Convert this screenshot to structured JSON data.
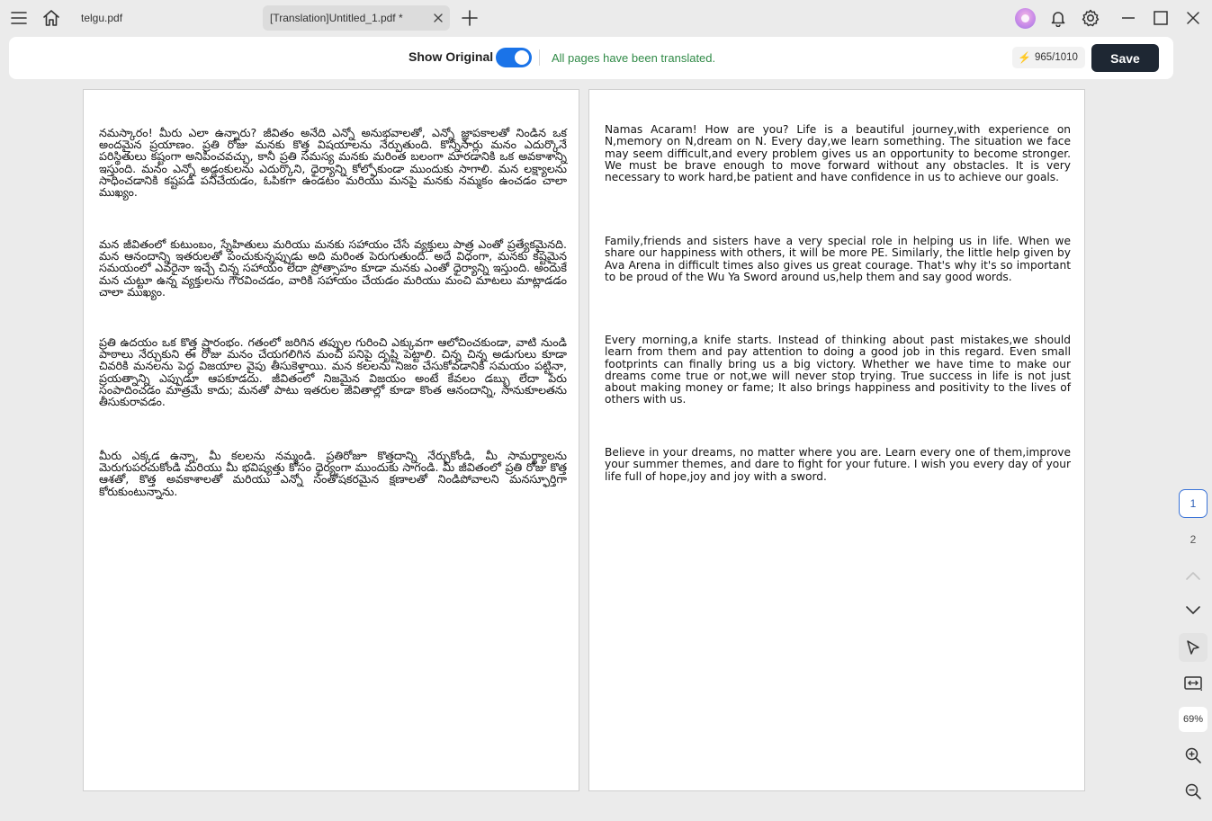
{
  "titlebar": {
    "tabs": [
      {
        "label": "telgu.pdf",
        "active": false
      },
      {
        "label": "[Translation]Untitled_1.pdf *",
        "active": true
      }
    ]
  },
  "toolbar": {
    "show_original_label": "Show Original",
    "show_original_on": true,
    "status": "All pages have been translated.",
    "credits": "965/1010",
    "save_label": "Save"
  },
  "original_page": {
    "paragraphs": [
      "నమస్కారం! మీరు ఎలా ఉన్నారు? జీవితం అనేది ఎన్నో అనుభవాలతో, ఎన్నో జ్ఞాపకాలతో నిండిన ఒక అందమైన ప్రయాణం. ప్రతి రోజు మనకు కొత్త విషయాలను నేర్పుతుంది. కొన్నిసార్లు మనం ఎదుర్కొనే పరిస్థితులు కష్టంగా అనిపించవచ్చు, కానీ ప్రతి సమస్య మనకు మరింత బలంగా మారడానికి ఒక అవకాశాన్ని ఇస్తుంది. మనం ఎన్నో అడ్డంకులను ఎదుర్కొని, ధైర్యాన్ని కోల్పోకుండా ముందుకు సాగాలి. మన లక్ష్యాలను సాధించడానికి కష్టపడి పనిచేయడం, ఓపికగా ఉండటం మరియు మనపై మనకు నమ్మకం ఉంచడం చాలా ముఖ్యం.",
      "మన జీవితంలో కుటుంబం, స్నేహితులు మరియు మనకు సహాయం చేసే వ్యక్తులు పాత్ర ఎంతో ప్రత్యేకమైనది. మన ఆనందాన్ని ఇతరులతో పంచుకున్నప్పుడు అది మరింత పెరుగుతుంది. అదే విధంగా, మనకు కష్టమైన సమయంలో ఎవరైనా ఇచ్చే చిన్న సహాయం లేదా ప్రోత్సాహం కూడా మనకు ఎంతో ధైర్యాన్ని ఇస్తుంది. అందుకే మన చుట్టూ ఉన్న వ్యక్తులను గౌరవించడం, వారికి సహాయం చేయడం మరియు మంచి మాటలు మాట్లాడడం చాలా ముఖ్యం.",
      "ప్రతి ఉదయం ఒక కొత్త ప్రారంభం. గతంలో జరిగిన తప్పుల గురించి ఎక్కువగా ఆలోచించకుండా, వాటి నుండి పాఠాలు నేర్చుకుని ఈ రోజు మనం చేయగలిగిన మంచి పనిపై దృష్టి పెట్టాలి. చిన్న చిన్న అడుగులు కూడా చివరికి మనలను పెద్ద విజయాల వైపు తీసుకెళ్తాయి. మన కలలను నిజం చేసుకోవడానికి సమయం పట్టినా, ప్రయత్నాన్ని ఎప్పుడూ ఆపకూడదు. జీవితంలో నిజమైన విజయం అంటే కేవలం డబ్బు లేదా పేరు సంపాదించడం మాత్రమే కాదు; మనతో పాటు ఇతరుల జీవితాల్లో కూడా కొంత ఆనందాన్ని, సానుకూలతను తీసుకురావడం.",
      "మీరు ఎక్కడ ఉన్నా, మీ కలలను నమ్మండి. ప్రతిరోజూ కొత్తదాన్ని నేర్చుకోండి, మీ సామర్థ్యాలను మెరుగుపరచుకోండి మరియు మీ భవిష్యత్తు కోసం ధైర్యంగా ముందుకు సాగండి. మీ జీవితంలో ప్రతి రోజు కొత్త ఆశతో, కొత్త అవకాశాలతో మరియు ఎన్నో సంతోషకరమైన క్షణాలతో నిండిపోవాలని మనస్ఫూర్తిగా కోరుకుంటున్నాను."
    ]
  },
  "translated_page": {
    "paragraphs": [
      "Namas Acaram! How are you? Life is a beautiful journey,with experience on N,memory on N,dream on N. Every day,we learn something. The situation we face may seem difficult,and every problem gives us an opportunity to become stronger. We must be brave enough to move forward without any obstacles. It is very necessary to work hard,be patient and have confidence in us to achieve our goals.",
      "Family,friends and sisters have a very special role in helping us in life. When we share our happiness  with others, it will be more PE. Similarly, the little help given by Ava Arena in difficult times also gives us great courage. That's why it's so important to be proud of the Wu Ya Sword around us,help them and say good words.",
      "Every morning,a knife starts. Instead of thinking about past mistakes,we should learn from them and pay attention to doing a good job in this regard. Even small footprints can finally bring us a big victory. Whether we have time to make our dreams come true or not,we will never stop trying. True success in life is not just about making money or fame; It also brings happiness and positivity to the lives of others with us.",
      "Believe  in your dreams, no matter where you are. Learn every one of them,improve your summer themes, and dare to fight for your future. I wish you every day of your life full of hope,joy and joy with a sword."
    ]
  },
  "sidebar": {
    "page_numbers": [
      "1",
      "2"
    ],
    "current_page": "1",
    "zoom": "69%"
  },
  "icons": [
    "menu-icon",
    "home-icon",
    "close-icon",
    "plus-icon",
    "avatar",
    "bell-icon",
    "gear-icon",
    "minimize-icon",
    "maximize-icon",
    "chevron-up-icon",
    "chevron-down-icon",
    "cursor-icon",
    "fit-page-icon",
    "zoom-in-icon",
    "zoom-out-icon"
  ]
}
